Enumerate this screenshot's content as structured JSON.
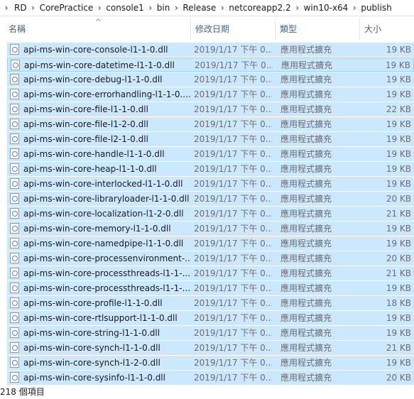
{
  "breadcrumb": [
    "RD",
    "CorePractice",
    "console1",
    "bin",
    "Release",
    "netcoreapp2.2",
    "win10-x64",
    "publish"
  ],
  "headers": {
    "sort_arrow": "^",
    "name": "名稱",
    "date": "修改日期",
    "type": "類型",
    "size": "大小"
  },
  "files": [
    {
      "name": "api-ms-win-core-console-l1-1-0.dll",
      "date": "2019/1/17 下午 0...",
      "type": "應用程式擴充",
      "size": "19 KB"
    },
    {
      "name": "api-ms-win-core-datetime-l1-1-0.dll",
      "date": "2019/1/17 下午 0...",
      "type": "應用程式擴充",
      "size": "19 KB"
    },
    {
      "name": "api-ms-win-core-debug-l1-1-0.dll",
      "date": "2019/1/17 下午 0...",
      "type": "應用程式擴充",
      "size": "19 KB"
    },
    {
      "name": "api-ms-win-core-errorhandling-l1-1-0....",
      "date": "2019/1/17 下午 0...",
      "type": "應用程式擴充",
      "size": "19 KB"
    },
    {
      "name": "api-ms-win-core-file-l1-1-0.dll",
      "date": "2019/1/17 下午 0...",
      "type": "應用程式擴充",
      "size": "22 KB"
    },
    {
      "name": "api-ms-win-core-file-l1-2-0.dll",
      "date": "2019/1/17 下午 0...",
      "type": "應用程式擴充",
      "size": "19 KB"
    },
    {
      "name": "api-ms-win-core-file-l2-1-0.dll",
      "date": "2019/1/17 下午 0...",
      "type": "應用程式擴充",
      "size": "19 KB"
    },
    {
      "name": "api-ms-win-core-handle-l1-1-0.dll",
      "date": "2019/1/17 下午 0...",
      "type": "應用程式擴充",
      "size": "19 KB"
    },
    {
      "name": "api-ms-win-core-heap-l1-1-0.dll",
      "date": "2019/1/17 下午 0...",
      "type": "應用程式擴充",
      "size": "19 KB"
    },
    {
      "name": "api-ms-win-core-interlocked-l1-1-0.dll",
      "date": "2019/1/17 下午 0...",
      "type": "應用程式擴充",
      "size": "19 KB"
    },
    {
      "name": "api-ms-win-core-libraryloader-l1-1-0.dll",
      "date": "2019/1/17 下午 0...",
      "type": "應用程式擴充",
      "size": "20 KB"
    },
    {
      "name": "api-ms-win-core-localization-l1-2-0.dll",
      "date": "2019/1/17 下午 0...",
      "type": "應用程式擴充",
      "size": "21 KB"
    },
    {
      "name": "api-ms-win-core-memory-l1-1-0.dll",
      "date": "2019/1/17 下午 0...",
      "type": "應用程式擴充",
      "size": "19 KB"
    },
    {
      "name": "api-ms-win-core-namedpipe-l1-1-0.dll",
      "date": "2019/1/17 下午 0...",
      "type": "應用程式擴充",
      "size": "19 KB"
    },
    {
      "name": "api-ms-win-core-processenvironment-...",
      "date": "2019/1/17 下午 0...",
      "type": "應用程式擴充",
      "size": "20 KB"
    },
    {
      "name": "api-ms-win-core-processthreads-l1-1-...",
      "date": "2019/1/17 下午 0...",
      "type": "應用程式擴充",
      "size": "21 KB"
    },
    {
      "name": "api-ms-win-core-processthreads-l1-1-...",
      "date": "2019/1/17 下午 0...",
      "type": "應用程式擴充",
      "size": "19 KB"
    },
    {
      "name": "api-ms-win-core-profile-l1-1-0.dll",
      "date": "2019/1/17 下午 0...",
      "type": "應用程式擴充",
      "size": "18 KB"
    },
    {
      "name": "api-ms-win-core-rtlsupport-l1-1-0.dll",
      "date": "2019/1/17 下午 0...",
      "type": "應用程式擴充",
      "size": "19 KB"
    },
    {
      "name": "api-ms-win-core-string-l1-1-0.dll",
      "date": "2019/1/17 下午 0...",
      "type": "應用程式擴充",
      "size": "19 KB"
    },
    {
      "name": "api-ms-win-core-synch-l1-1-0.dll",
      "date": "2019/1/17 下午 0...",
      "type": "應用程式擴充",
      "size": "21 KB"
    },
    {
      "name": "api-ms-win-core-synch-l1-2-0.dll",
      "date": "2019/1/17 下午 0...",
      "type": "應用程式擴充",
      "size": "19 KB"
    },
    {
      "name": "api-ms-win-core-sysinfo-l1-1-0.dll",
      "date": "2019/1/17 下午 0...",
      "type": "應用程式擴充",
      "size": "20 KB"
    }
  ],
  "focused_index": 1,
  "status": {
    "item_count": "218 個項目"
  },
  "colors": {
    "selection": "#cce8ff",
    "focus_border": "#99d1ff",
    "header_text": "#4c607a",
    "secondary_text": "#6d6d6d"
  },
  "icons": {
    "file_icon": "dll-file-icon",
    "breadcrumb_separator": "chevron-right-icon",
    "sort_indicator": "sort-ascending-icon"
  }
}
